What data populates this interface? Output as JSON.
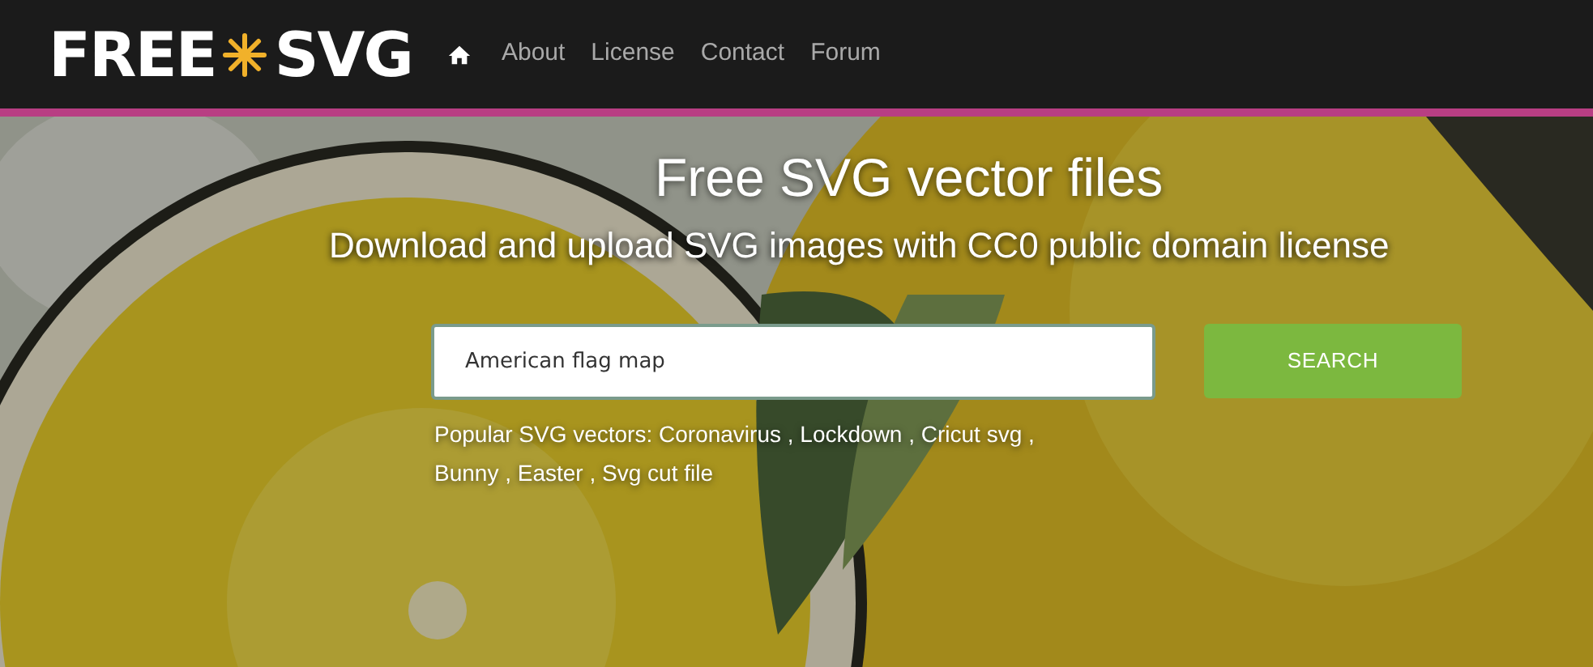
{
  "logo": {
    "left": "FREE",
    "right": "SVG"
  },
  "nav": [
    {
      "kind": "home"
    },
    {
      "kind": "link",
      "label": "About"
    },
    {
      "kind": "link",
      "label": "License"
    },
    {
      "kind": "link",
      "label": "Contact"
    },
    {
      "kind": "link",
      "label": "Forum"
    }
  ],
  "hero": {
    "title": "Free SVG vector files",
    "subtitle": "Download and upload SVG images with CC0 public domain license"
  },
  "search": {
    "value": "American flag map",
    "button": "SEARCH"
  },
  "popular": {
    "label": "Popular SVG vectors:",
    "separator": ",",
    "tags": [
      "Coronavirus",
      "Lockdown",
      "Cricut svg",
      "Bunny",
      "Easter",
      "Svg cut file"
    ]
  }
}
